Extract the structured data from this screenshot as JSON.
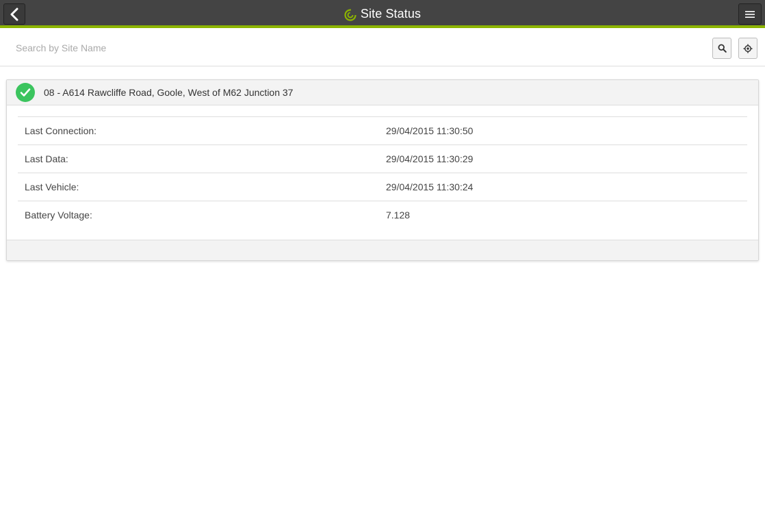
{
  "header": {
    "title": "Site Status",
    "accent_color": "#8cb400",
    "background_color": "#444444",
    "logo_icon": "app-logo-icon",
    "back_icon": "chevron-left-icon",
    "menu_icon": "hamburger-menu-icon"
  },
  "search": {
    "placeholder": "Search by Site Name",
    "value": "",
    "search_icon": "search-icon",
    "locate_icon": "crosshair-location-icon"
  },
  "site": {
    "status": "ok",
    "status_color": "#3bc45e",
    "status_icon": "checkmark-icon",
    "name": "08 - A614 Rawcliffe Road, Goole, West of M62 Junction 37",
    "details": [
      {
        "label": "Last Connection:",
        "value": "29/04/2015 11:30:50"
      },
      {
        "label": "Last Data:",
        "value": "29/04/2015 11:30:29"
      },
      {
        "label": "Last Vehicle:",
        "value": "29/04/2015 11:30:24"
      },
      {
        "label": "Battery Voltage:",
        "value": "7.128"
      }
    ]
  }
}
